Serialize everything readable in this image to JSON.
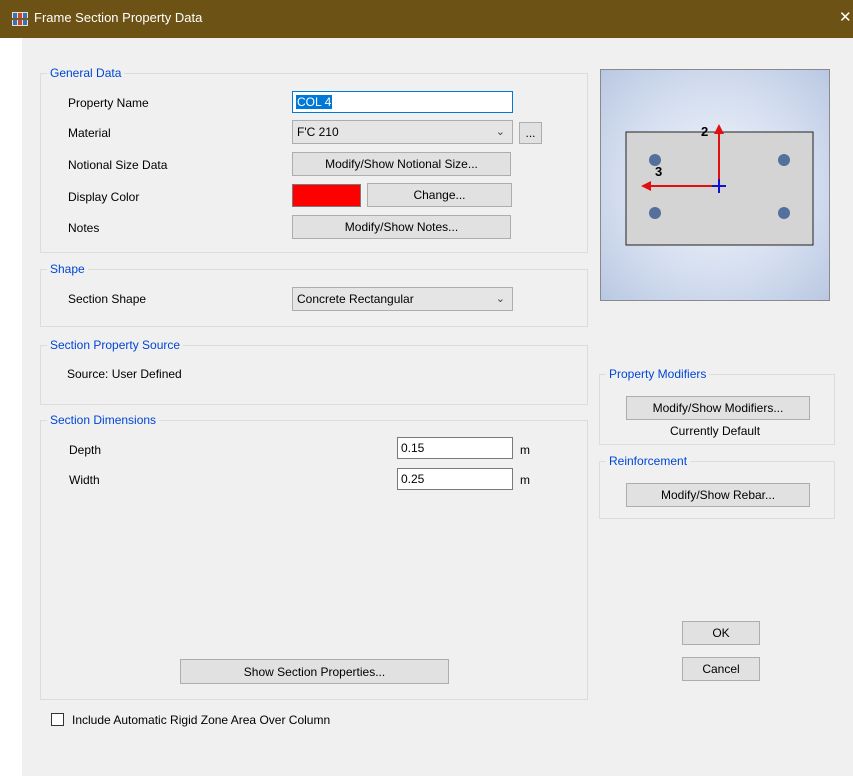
{
  "window": {
    "title": "Frame Section Property Data",
    "close_glyph": "✕"
  },
  "general_data": {
    "legend": "General Data",
    "property_name_label": "Property Name",
    "property_name_value": "COL 4",
    "material_label": "Material",
    "material_value": "F'C 210",
    "material_more_button": "...",
    "notional_label": "Notional Size Data",
    "notional_button": "Modify/Show Notional Size...",
    "display_color_label": "Display Color",
    "display_color_value": "#ff0000",
    "change_button": "Change...",
    "notes_label": "Notes",
    "notes_button": "Modify/Show Notes..."
  },
  "shape": {
    "legend": "Shape",
    "section_shape_label": "Section Shape",
    "section_shape_value": "Concrete Rectangular"
  },
  "source": {
    "legend": "Section Property Source",
    "source_text": "Source:  User Defined"
  },
  "dimensions": {
    "legend": "Section Dimensions",
    "depth_label": "Depth",
    "depth_value": "0.15",
    "depth_unit": "m",
    "width_label": "Width",
    "width_value": "0.25",
    "width_unit": "m",
    "show_props_button": "Show Section Properties..."
  },
  "preview": {
    "axis2_label": "2",
    "axis3_label": "3"
  },
  "modifiers": {
    "legend": "Property Modifiers",
    "button": "Modify/Show Modifiers...",
    "status": "Currently Default"
  },
  "reinforcement": {
    "legend": "Reinforcement",
    "button": "Modify/Show Rebar..."
  },
  "actions": {
    "ok": "OK",
    "cancel": "Cancel"
  },
  "rigid_zone": {
    "label": "Include Automatic Rigid Zone Area Over Column",
    "checked": false
  },
  "icons": {
    "app": "etabs-app-icon",
    "dropdown": "chevron-down-icon",
    "close": "close-icon"
  },
  "colors": {
    "titlebar": "#6c5214",
    "legend_text": "#0046d5",
    "dialog_bg": "#f0f0f0"
  }
}
